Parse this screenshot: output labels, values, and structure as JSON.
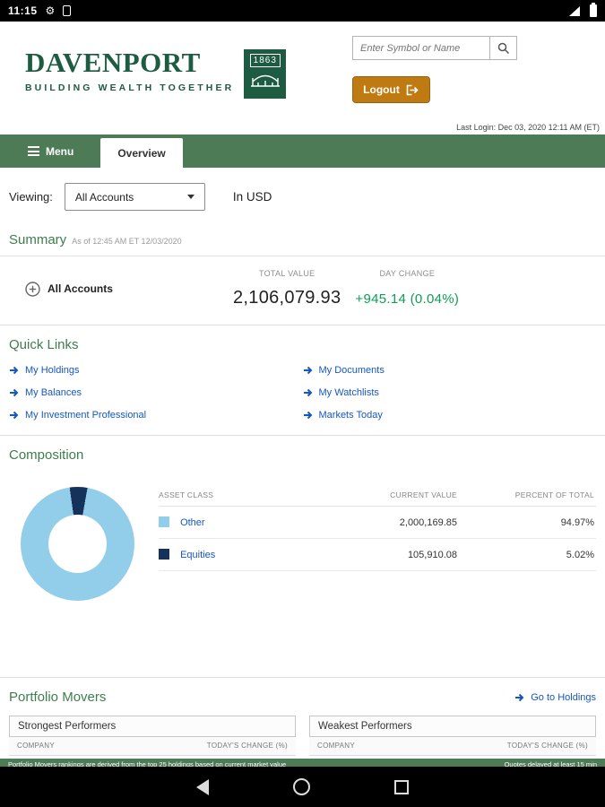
{
  "status_bar": {
    "time": "11:15"
  },
  "header": {
    "logo": {
      "name": "DAVENPORT",
      "tagline": "BUILDING WEALTH TOGETHER",
      "badge_year": "1863"
    },
    "search": {
      "placeholder": "Enter Symbol or Name"
    },
    "logout_label": "Logout",
    "last_login": "Last Login: Dec 03, 2020 12:11 AM (ET)"
  },
  "nav": {
    "menu_label": "Menu",
    "active_tab": "Overview"
  },
  "viewing": {
    "label": "Viewing:",
    "selected": "All Accounts",
    "currency_note": "In USD"
  },
  "summary": {
    "title": "Summary",
    "as_of": "As of 12:45 AM ET 12/03/2020",
    "account_label": "All Accounts",
    "total_value_label": "TOTAL VALUE",
    "total_value": "2,106,079.93",
    "day_change_label": "DAY CHANGE",
    "day_change": "+945.14 (0.04%)"
  },
  "quick_links": {
    "title": "Quick Links",
    "col1": [
      "My Holdings",
      "My Balances",
      "My Investment Professional"
    ],
    "col2": [
      "My Documents",
      "My Watchlists",
      "Markets Today"
    ]
  },
  "composition": {
    "title": "Composition",
    "table": {
      "headers": [
        "ASSET CLASS",
        "CURRENT VALUE",
        "PERCENT OF TOTAL"
      ],
      "rows": [
        {
          "asset_class": "Other",
          "color": "#92cdea",
          "current_value": "2,000,169.85",
          "percent": "94.97%"
        },
        {
          "asset_class": "Equities",
          "color": "#14325a",
          "current_value": "105,910.08",
          "percent": "5.02%"
        }
      ]
    }
  },
  "chart_data": {
    "type": "pie",
    "subtype": "donut",
    "title": "Composition",
    "categories": [
      "Other",
      "Equities"
    ],
    "values": [
      94.97,
      5.02
    ],
    "colors": [
      "#92cdea",
      "#14325a"
    ],
    "legend_position": "table-right"
  },
  "portfolio_movers": {
    "title": "Portfolio Movers",
    "go_to_holdings": "Go to Holdings",
    "panels": [
      {
        "title": "Strongest Performers",
        "columns": [
          "COMPANY",
          "TODAY'S CHANGE (%)"
        ]
      },
      {
        "title": "Weakest Performers",
        "columns": [
          "COMPANY",
          "TODAY'S CHANGE (%)"
        ]
      }
    ],
    "disclaimer_left": "Portfolio Movers rankings are derived from the top 25 holdings based on current market value",
    "disclaimer_right": "Quotes delayed at least 15 min"
  },
  "colors": {
    "brand_green": "#1d5c40",
    "nav_green": "#4c7b55",
    "heading_green": "#3e7d4e",
    "link_blue": "#1557c0",
    "positive_green": "#0f9d58",
    "logout_orange": "#c07a12"
  }
}
